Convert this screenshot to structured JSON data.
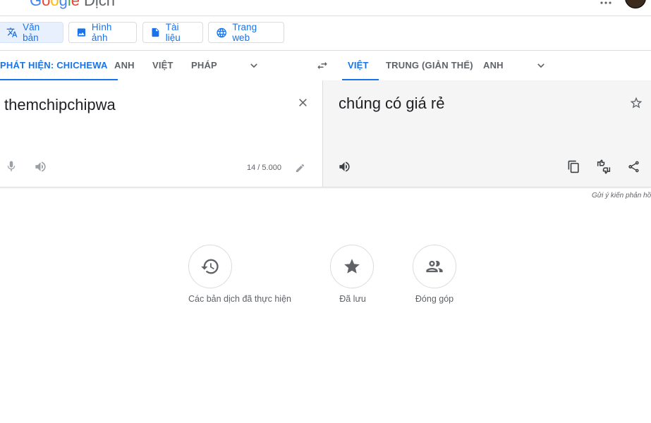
{
  "header": {
    "logo_letters": [
      "G",
      "o",
      "o",
      "g",
      "l",
      "e"
    ],
    "product": "Dịch"
  },
  "modes": [
    {
      "label": "Văn bản",
      "icon": "translate-icon",
      "active": true
    },
    {
      "label": "Hình ảnh",
      "icon": "image-icon",
      "active": false
    },
    {
      "label": "Tài liệu",
      "icon": "document-icon",
      "active": false
    },
    {
      "label": "Trang web",
      "icon": "globe-icon",
      "active": false
    }
  ],
  "source_languages": {
    "detected": "PHÁT HIỆN: CHICHEWA",
    "options": [
      "ANH",
      "VIỆT",
      "PHÁP"
    ]
  },
  "target_languages": {
    "selected": "VIỆT",
    "options": [
      "TRUNG (GIẢN THỂ)",
      "ANH"
    ]
  },
  "source": {
    "text": "themchipchipwa",
    "char_count": "14 / 5.000"
  },
  "target": {
    "text": "chúng có giá rẻ"
  },
  "feedback_link": "Gửi ý kiến phản hồi",
  "bottom_actions": [
    {
      "label": "Các bản dịch đã thực hiện",
      "icon": "history-icon"
    },
    {
      "label": "Đã lưu",
      "icon": "star-icon"
    },
    {
      "label": "Đóng góp",
      "icon": "people-icon"
    }
  ],
  "colors": {
    "accent": "#1a73e8",
    "muted": "#5f6368",
    "target_bg": "#f5f5f5"
  }
}
